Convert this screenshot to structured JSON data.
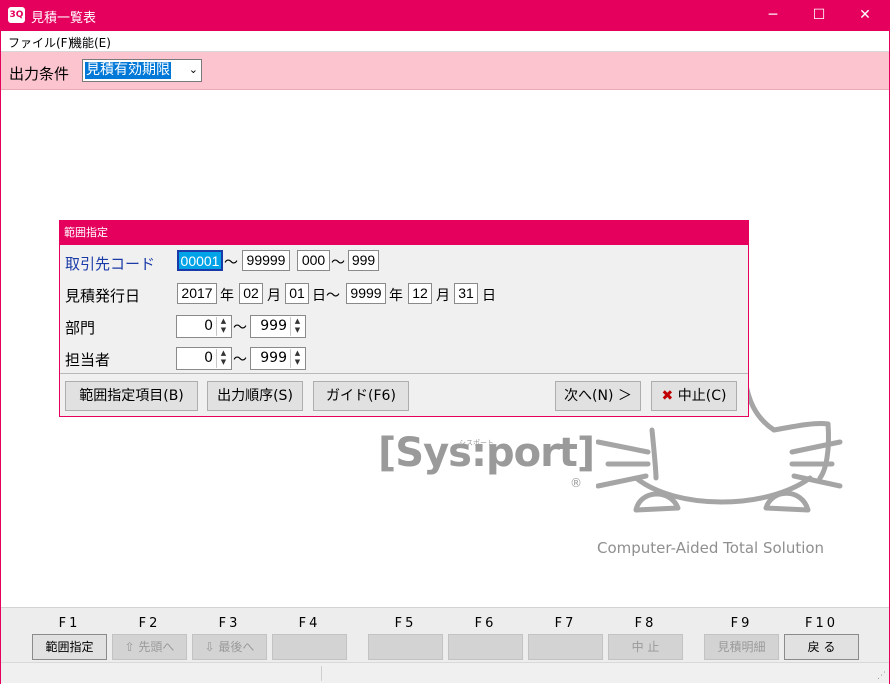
{
  "window": {
    "title": "見積一覧表",
    "icon_text": "3Q",
    "minimize": "─",
    "maximize": "☐",
    "close": "✕"
  },
  "menu": [
    {
      "label": "ファイル(F)"
    },
    {
      "label": "機能(E)"
    }
  ],
  "condition": {
    "label": "出力条件",
    "selected": "見積有効期限",
    "arrow": "⌄"
  },
  "dialog": {
    "title": "範囲指定",
    "rows": {
      "customer": {
        "label": "取引先コード",
        "from": "00001",
        "tilde1": "～",
        "to": "99999",
        "sub_from": "000",
        "tilde2": "～",
        "sub_to": "999"
      },
      "date": {
        "label": "見積発行日",
        "from_year": "2017",
        "year": "年",
        "from_month": "02",
        "month": "月",
        "from_day": "01",
        "day": "日～",
        "to_year": "9999",
        "year2": "年",
        "to_month": "12",
        "month2": "月",
        "to_day": "31",
        "day2": "日"
      },
      "dept": {
        "label": "部門",
        "from": "0",
        "tilde": "～",
        "to": "999"
      },
      "staff": {
        "label": "担当者",
        "from": "0",
        "tilde": "～",
        "to": "999"
      }
    },
    "buttons": {
      "range_items": "範囲指定項目(B)",
      "output_order": "出力順序(S)",
      "guide": "ガイド(F6)",
      "next": "次へ(N) ＞",
      "cancel_mark": "✖",
      "cancel": "中止(C)"
    }
  },
  "logo": {
    "brand": "[Sys:port]",
    "reading": "シスポート",
    "registered": "®",
    "tagline": "Computer-Aided Total Solution"
  },
  "fkeys": [
    {
      "key": "F1",
      "label": "範囲指定",
      "enabled": true
    },
    {
      "key": "F2",
      "label": "⇧ 先頭へ",
      "enabled": false
    },
    {
      "key": "F3",
      "label": "⇩ 最後へ",
      "enabled": false
    },
    {
      "key": "F4",
      "label": "",
      "enabled": false
    },
    {
      "key": "F5",
      "label": "",
      "enabled": false
    },
    {
      "key": "F6",
      "label": "",
      "enabled": false
    },
    {
      "key": "F7",
      "label": "",
      "enabled": false
    },
    {
      "key": "F8",
      "label": "中 止",
      "enabled": false
    },
    {
      "key": "F9",
      "label": "見積明細",
      "enabled": false
    },
    {
      "key": "F10",
      "label": "戻 る",
      "enabled": true
    }
  ],
  "colors": {
    "accent": "#e6005e",
    "condition_bg": "#fbc4ce",
    "selection": "#0078d7",
    "field_focus": "#00a2e8",
    "label_blue": "#1a3aa8"
  }
}
